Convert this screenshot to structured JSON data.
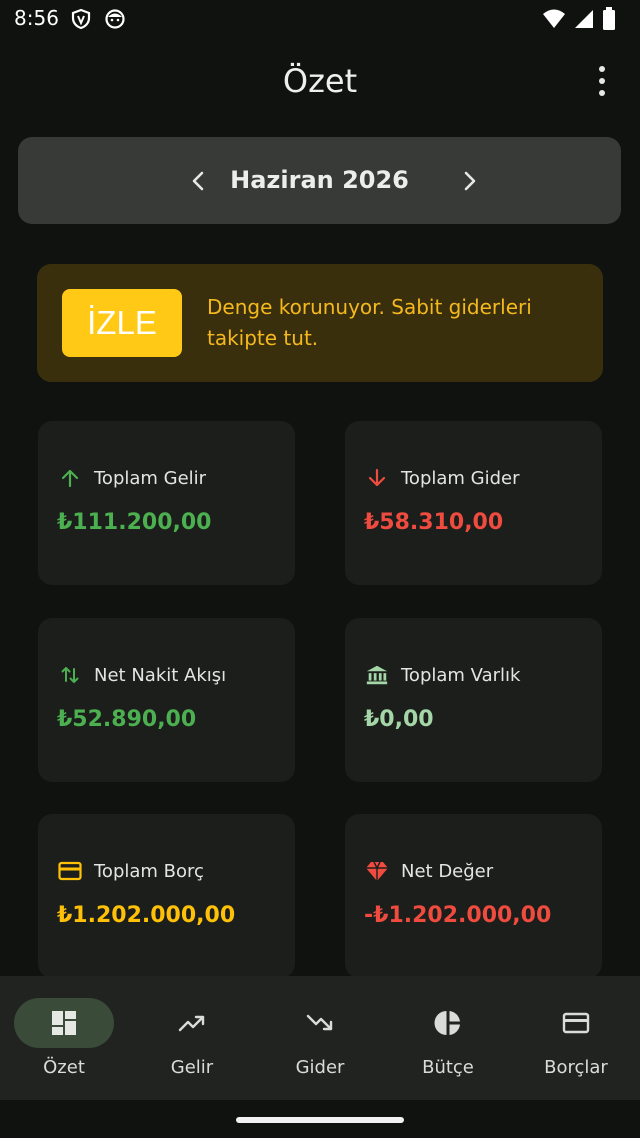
{
  "status_bar": {
    "time": "8:56",
    "icons_left": [
      "shield-icon",
      "face-icon"
    ],
    "icons_right": [
      "wifi-icon",
      "cellular-icon",
      "battery-icon"
    ]
  },
  "app_bar": {
    "title": "Özet",
    "menu_icon": "more-vertical-icon"
  },
  "month_selector": {
    "label": "Haziran 2026",
    "prev_icon": "chevron-left-icon",
    "next_icon": "chevron-right-icon"
  },
  "alert": {
    "badge": "İZLE",
    "message": "Denge korunuyor. Sabit giderleri takipte tut.",
    "colors": {
      "background": "#3a2f0d",
      "badge": "#ffc915",
      "text": "#f5b91e"
    }
  },
  "stats": {
    "income": {
      "label": "Toplam Gelir",
      "value": "₺111.200,00",
      "icon": "arrow-up-icon",
      "color": "#4caf50"
    },
    "expense": {
      "label": "Toplam Gider",
      "value": "₺58.310,00",
      "icon": "arrow-down-icon",
      "color": "#ef4b3f"
    },
    "net_cash_flow": {
      "label": "Net Nakit Akışı",
      "value": "₺52.890,00",
      "icon": "swap-vertical-icon",
      "color": "#4caf50"
    },
    "assets": {
      "label": "Toplam Varlık",
      "value": "₺0,00",
      "icon": "bank-icon",
      "color": "#a5d6a7"
    },
    "debt": {
      "label": "Toplam Borç",
      "value": "₺1.202.000,00",
      "icon": "credit-card-icon",
      "color": "#ffc107"
    },
    "net_worth": {
      "label": "Net Değer",
      "value": "-₺1.202.000,00",
      "icon": "diamond-icon",
      "color": "#ef4b3f"
    }
  },
  "bottom_nav": {
    "items": [
      {
        "label": "Özet",
        "icon": "dashboard-icon",
        "active": true
      },
      {
        "label": "Gelir",
        "icon": "trending-up-icon",
        "active": false
      },
      {
        "label": "Gider",
        "icon": "trending-down-icon",
        "active": false
      },
      {
        "label": "Bütçe",
        "icon": "pie-chart-icon",
        "active": false
      },
      {
        "label": "Borçlar",
        "icon": "credit-card-icon",
        "active": false
      }
    ]
  }
}
